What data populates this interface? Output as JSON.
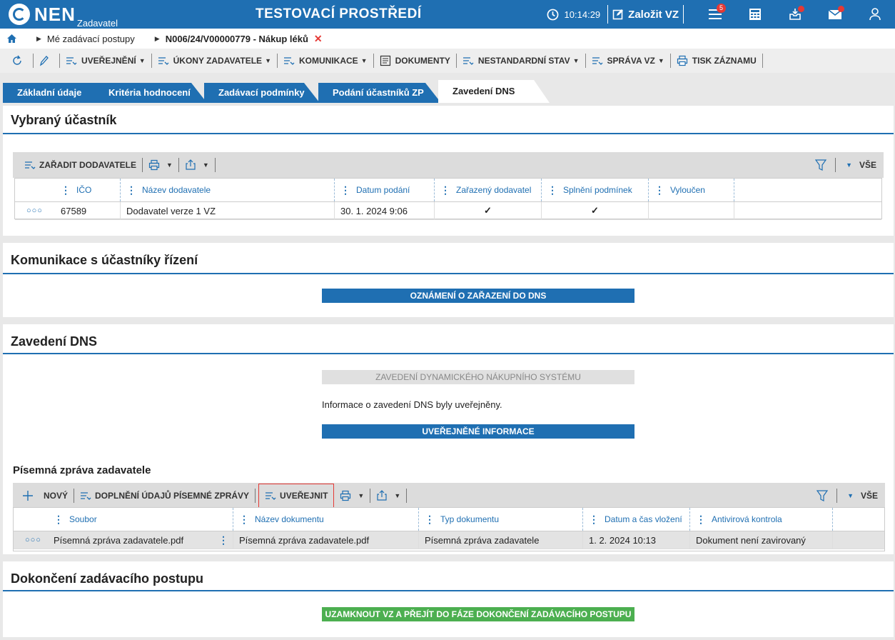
{
  "app": {
    "logo": "NEN",
    "logo_sub": "Zadavatel",
    "env_title": "TESTOVACÍ PROSTŘEDÍ",
    "time": "10:14:29",
    "new_vz": "Založit VZ",
    "menu_badge": "5"
  },
  "breadcrumb": {
    "item1": "Mé zadávací postupy",
    "item2": "N006/24/V00000779 - Nákup léků",
    "close": "✕"
  },
  "toolbar": {
    "publish": "UVEŘEJNĚNÍ",
    "acts": "ÚKONY ZADAVATELE",
    "comm": "KOMUNIKACE",
    "docs": "DOKUMENTY",
    "nonstd": "NESTANDARDNÍ STAV",
    "manage": "SPRÁVA VZ",
    "print": "TISK ZÁZNAMU"
  },
  "tabs": [
    "Základní údaje",
    "Kritéria hodnocení",
    "Zadávací podmínky",
    "Podání účastníků ZP",
    "Zavedení DNS"
  ],
  "section1": {
    "title": "Vybraný účastník",
    "add_supplier": "ZAŘADIT DODAVATELE",
    "all": "VŠE",
    "columns": [
      "IČO",
      "Název dodavatele",
      "Datum podání",
      "Zařazený dodavatel",
      "Splnění podmínek",
      "Vyloučen"
    ],
    "row": {
      "ico": "67589",
      "name": "Dodavatel verze 1 VZ",
      "date": "30. 1. 2024 9:06",
      "included": "✓",
      "conditions": "✓",
      "excluded": ""
    }
  },
  "section2": {
    "title": "Komunikace s účastníky řízení",
    "button": "OZNÁMENÍ O ZAŘAZENÍ DO DNS"
  },
  "section3": {
    "title": "Zavedení DNS",
    "disabled_button": "ZAVEDENÍ DYNAMICKÉHO NÁKUPNÍHO SYSTÉMU",
    "info": "Informace o zavedení DNS byly uveřejněny.",
    "published_button": "UVEŘEJNĚNÉ INFORMACE",
    "report_title": "Písemná zpráva zadavatele",
    "new": "NOVÝ",
    "supplement": "DOPLNĚNÍ ÚDAJŮ PÍSEMNÉ ZPRÁVY",
    "publish": "UVEŘEJNIT",
    "all": "VŠE",
    "columns": [
      "Soubor",
      "Název dokumentu",
      "Typ dokumentu",
      "Datum a čas vložení",
      "Antivirová kontrola"
    ],
    "row": {
      "file": "Písemná zpráva zadavatele.pdf",
      "name": "Písemná zpráva zadavatele.pdf",
      "type": "Písemná zpráva zadavatele",
      "date": "1. 2. 2024 10:13",
      "av": "Dokument není zavirovaný"
    }
  },
  "section4": {
    "title": "Dokončení zadávacího postupu",
    "button": "UZAMKNOUT VZ A PŘEJÍT DO FÁZE DOKONČENÍ ZADÁVACÍHO POSTUPU"
  },
  "colors": {
    "primary": "#1f6fb2",
    "success": "#4caf50",
    "danger": "#e53935"
  }
}
